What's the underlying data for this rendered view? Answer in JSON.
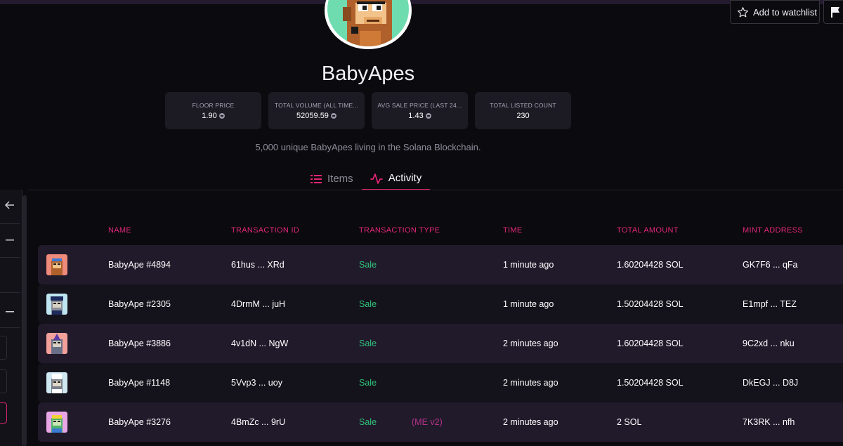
{
  "collection": {
    "name": "BabyApes",
    "description": "5,000 unique BabyApes living in the Solana Blockchain."
  },
  "header": {
    "watchlist_label": "Add to watchlist"
  },
  "stats": [
    {
      "label": "FLOOR PRICE",
      "value": "1.90"
    },
    {
      "label": "TOTAL VOLUME (ALL TIME...",
      "value": "52059.59"
    },
    {
      "label": "AVG SALE PRICE (LAST 24...",
      "value": "1.43"
    },
    {
      "label": "TOTAL LISTED COUNT",
      "value": "230"
    }
  ],
  "tabs": [
    {
      "label": "Items",
      "icon": "list-icon",
      "active": false
    },
    {
      "label": "Activity",
      "icon": "activity-icon",
      "active": true
    }
  ],
  "table": {
    "columns": [
      "NAME",
      "TRANSACTION ID",
      "TRANSACTION TYPE",
      "TIME",
      "TOTAL AMOUNT",
      "MINT ADDRESS"
    ],
    "rows": [
      {
        "name": "BabyApe #4894",
        "tx_id": "61hus ... XRd",
        "type": "Sale",
        "tag": "",
        "time": "1 minute ago",
        "amount": "1.60204428 SOL",
        "mint": "GK7F6 ... qFa",
        "thumb_bg": "#f08a7a"
      },
      {
        "name": "BabyApe #2305",
        "tx_id": "4DrmM ... juH",
        "type": "Sale",
        "tag": "",
        "time": "1 minute ago",
        "amount": "1.50204428 SOL",
        "mint": "E1mpf ... TEZ",
        "thumb_bg": "#bfe6f0"
      },
      {
        "name": "BabyApe #3886",
        "tx_id": "4v1dN ... NgW",
        "type": "Sale",
        "tag": "",
        "time": "2 minutes ago",
        "amount": "1.60204428 SOL",
        "mint": "9C2xd ... nku",
        "thumb_bg": "#f3a09a"
      },
      {
        "name": "BabyApe #1148",
        "tx_id": "5Vvp3 ... uoy",
        "type": "Sale",
        "tag": "",
        "time": "2 minutes ago",
        "amount": "1.50204428 SOL",
        "mint": "DkEGJ ... D8J",
        "thumb_bg": "#cfe8f2"
      },
      {
        "name": "BabyApe #3276",
        "tx_id": "4BmZc ... 9rU",
        "type": "Sale",
        "tag": "(ME v2)",
        "time": "2 minutes ago",
        "amount": "2 SOL",
        "mint": "7K3RK ... nfh",
        "thumb_bg": "#e9a6e6"
      }
    ]
  },
  "colors": {
    "accent": "#e42575",
    "sale": "#2fc27a",
    "background": "#0b0a0e"
  }
}
